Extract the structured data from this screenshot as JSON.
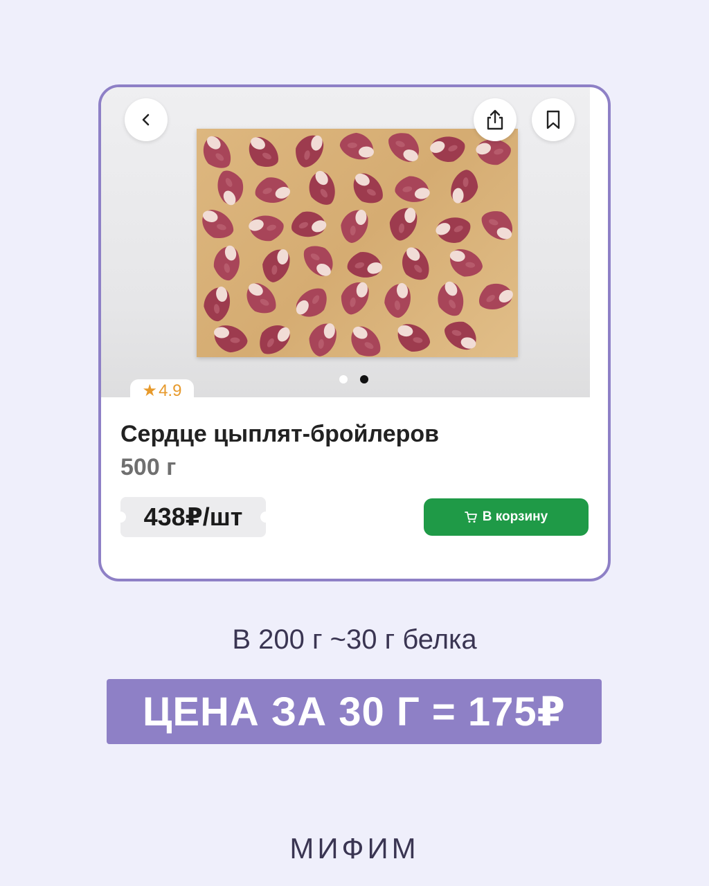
{
  "card": {
    "image_alt": "chicken-hearts-on-board",
    "rating": "4.9",
    "title": "Сердце цыплят-бройлеров",
    "weight": "500 г",
    "price": "438₽/шт",
    "cart_label": "В корзину",
    "carousel": {
      "total": 2,
      "active": 2
    }
  },
  "info": {
    "protein_text": "В 200 г ~30 г белка",
    "banner_text": "ЦЕНА ЗА 30 Г = 175₽"
  },
  "brand": "МИФИМ",
  "colors": {
    "accent": "#8e80c6",
    "background": "#efeffb",
    "cart_button": "#1f9a47",
    "rating": "#e79a2c"
  },
  "icons": {
    "back": "chevron-left-icon",
    "share": "share-icon",
    "bookmark": "bookmark-icon",
    "cart": "cart-icon",
    "rating": "star-icon"
  }
}
